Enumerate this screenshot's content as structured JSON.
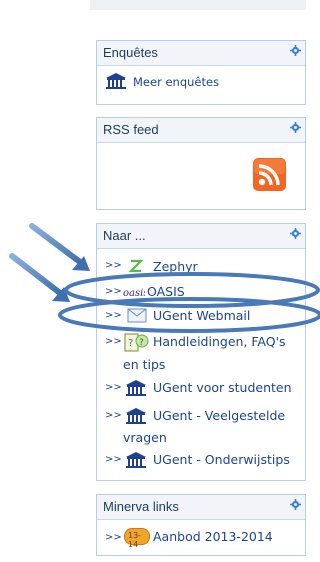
{
  "blocks": {
    "enquetes": {
      "title": "Enquêtes",
      "link": "Meer enquêtes"
    },
    "rss": {
      "title": "RSS feed"
    },
    "naar": {
      "title": "Naar ...",
      "items": [
        {
          "prefix": ">>",
          "label": "Zephyr",
          "icon": "zephyr-icon"
        },
        {
          "prefix": ">>",
          "label": "OASIS",
          "icon": "oasis-logo-icon"
        },
        {
          "prefix": ">>",
          "label": "UGent Webmail",
          "icon": "envelope-icon"
        },
        {
          "prefix": ">>",
          "label_line1": "Handleidingen, FAQ's",
          "label_line2": "en tips",
          "icon": "help-doc-icon"
        },
        {
          "prefix": ">>",
          "label": "UGent voor studenten",
          "icon": "building-icon"
        },
        {
          "prefix": ">>",
          "label_line1": "UGent - Veelgestelde",
          "label_line2": "vragen",
          "icon": "building-icon"
        },
        {
          "prefix": ">>",
          "label": "UGent - Onderwijstips",
          "icon": "building-icon"
        }
      ]
    },
    "minerva": {
      "title": "Minerva links",
      "items": [
        {
          "prefix": ">>",
          "label": "Aanbod 2013-2014",
          "icon": "year-badge-icon",
          "badge_text": "13-14"
        }
      ]
    }
  },
  "colors": {
    "link": "#1c4494",
    "border": "#b9cde3",
    "header_bg": "#f1f5fa",
    "rss_orange": "#f26522",
    "annotation_blue": "#4a79b8"
  }
}
